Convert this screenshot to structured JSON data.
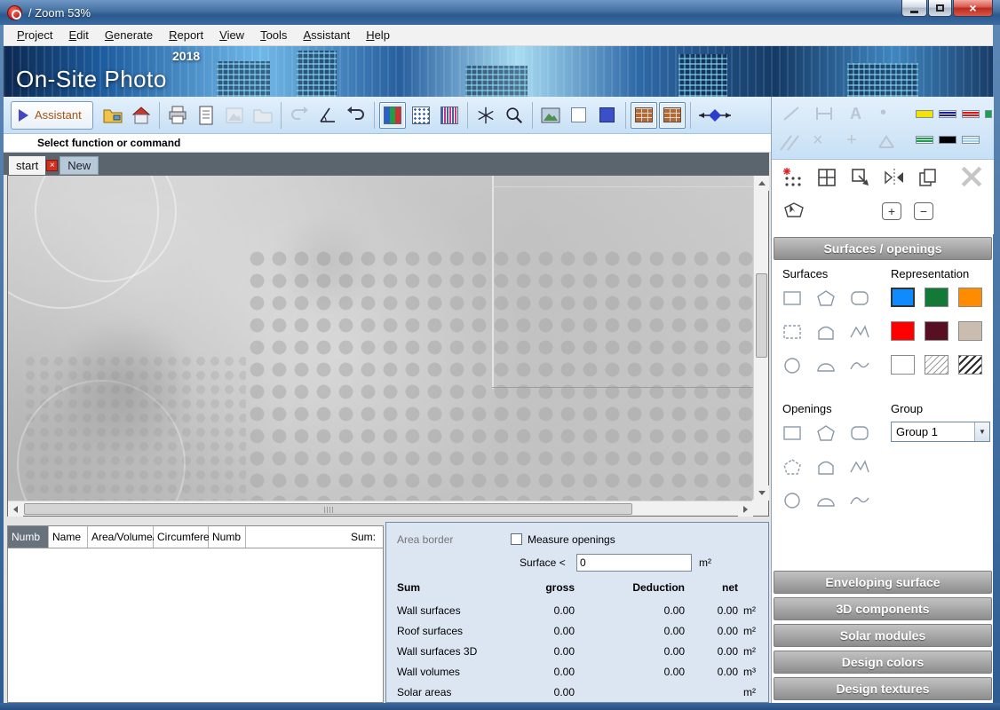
{
  "window": {
    "title": "/ Zoom 53%"
  },
  "menu": {
    "items": [
      "Project",
      "Edit",
      "Generate",
      "Report",
      "View",
      "Tools",
      "Assistant",
      "Help"
    ]
  },
  "banner": {
    "year": "2018",
    "title": "On-Site Photo"
  },
  "toolbar": {
    "assistant_label": "Assistant"
  },
  "status": {
    "text": "Select function or command"
  },
  "tabs": {
    "start": "start",
    "new": "New"
  },
  "right_panel": {
    "header": "Surfaces / openings",
    "surfaces_label": "Surfaces",
    "representation_label": "Representation",
    "openings_label": "Openings",
    "group_label": "Group",
    "group_value": "Group 1",
    "representation_colors": [
      "#0f8bff",
      "#127a36",
      "#ff8c00",
      "#fe0000",
      "#571022",
      "#cabcae",
      "#ffffff",
      "hatch-light",
      "hatch-dark"
    ],
    "chip_colors": [
      "#f2e400",
      "#1a1a9c",
      "#e01616",
      "#1da04e",
      "#1da04e",
      "#000000",
      "#a6d0ee"
    ],
    "buttons": [
      "Enveloping surface",
      "3D components",
      "Solar modules",
      "Design colors",
      "Design textures"
    ]
  },
  "results_table": {
    "headers": [
      "Numb",
      "Name",
      "Area/Volume/",
      "Circumfere",
      "Numb"
    ],
    "sum_header": "Sum:"
  },
  "measure": {
    "area_border_label": "Area border",
    "measure_openings_label": "Measure openings",
    "surface_label": "Surface <",
    "surface_value": "0",
    "surface_unit": "m²",
    "sum_label": "Sum",
    "col_gross": "gross",
    "col_deduction": "Deduction",
    "col_net": "net",
    "rows": [
      {
        "label": "Wall surfaces",
        "gross": "0.00",
        "deduction": "0.00",
        "net": "0.00",
        "unit": "m²"
      },
      {
        "label": "Roof surfaces",
        "gross": "0.00",
        "deduction": "0.00",
        "net": "0.00",
        "unit": "m²"
      },
      {
        "label": "Wall surfaces 3D",
        "gross": "0.00",
        "deduction": "0.00",
        "net": "0.00",
        "unit": "m²"
      },
      {
        "label": "Wall volumes",
        "gross": "0.00",
        "deduction": "0.00",
        "net": "0.00",
        "unit": "m³"
      },
      {
        "label": "Solar areas",
        "gross": "0.00",
        "deduction": "",
        "net": "",
        "unit": "m²"
      }
    ]
  },
  "icons": {
    "close": "×",
    "zoom_in": "+",
    "zoom_out": "−",
    "dropdown_arrow": "▼",
    "letter_a": "A",
    "dot": "•",
    "cross": "×",
    "plus": "+"
  }
}
